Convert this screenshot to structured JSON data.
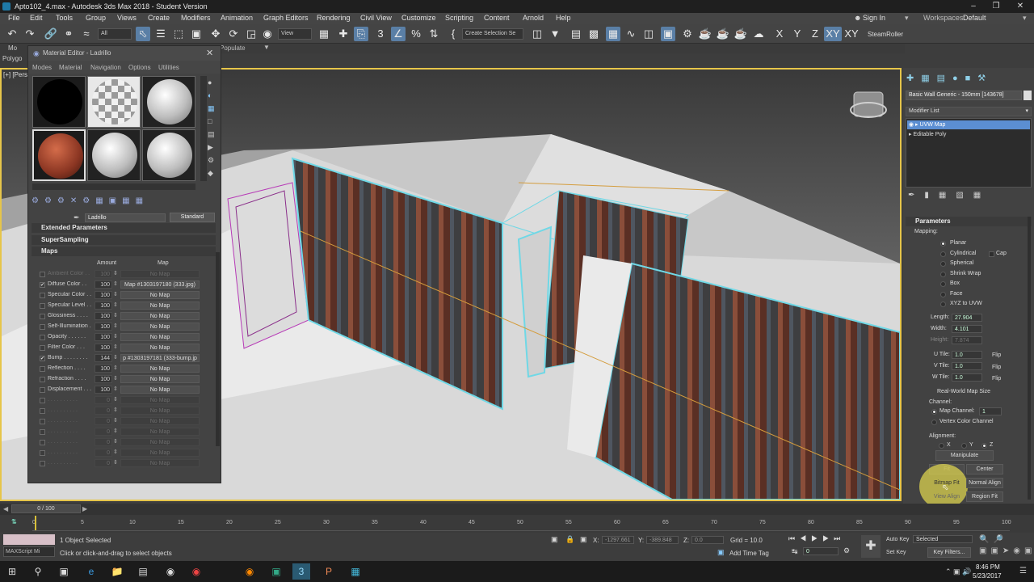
{
  "title": "Apto102_4.max - Autodesk 3ds Max 2018 - Student Version",
  "menu": [
    "File",
    "Edit",
    "Tools",
    "Group",
    "Views",
    "Create",
    "Modifiers",
    "Animation",
    "Graph Editors",
    "Rendering",
    "Civil View",
    "Customize",
    "Scripting",
    "Content",
    "Arnold",
    "Help"
  ],
  "signin": "Sign In",
  "workspaces_label": "Workspaces:",
  "workspace_value": "Default",
  "toolbar": {
    "filter_value": "All",
    "view_value": "View",
    "selection_set": "Create Selection Se",
    "axis_x": "X",
    "axis_y": "Y",
    "axis_z": "Z",
    "axis_xy": "XY",
    "axis_xy2": "XY",
    "steamroller": "SteamRoller"
  },
  "ribbon": {
    "populate": "Populate",
    "modeling": "Mo",
    "polygon": "Polygo"
  },
  "viewport_label": "[+] [Pers",
  "material_editor": {
    "title": "Material Editor - Ladrillo",
    "menu": [
      "Modes",
      "Material",
      "Navigation",
      "Options",
      "Utilities"
    ],
    "material_name": "Ladrillo",
    "material_type": "Standard",
    "rollouts": {
      "extended": "Extended Parameters",
      "supersampling": "SuperSampling",
      "maps": "Maps"
    },
    "col_amount": "Amount",
    "col_map": "Map",
    "maps": [
      {
        "name": "Ambient Color . .",
        "amount": "100",
        "map": "No Map",
        "checked": false,
        "dim": true
      },
      {
        "name": "Diffuse Color . .",
        "amount": "100",
        "map": "Map #1303197180 (333.jpg)",
        "checked": true,
        "dim": false
      },
      {
        "name": "Specular Color . .",
        "amount": "100",
        "map": "No Map",
        "checked": false,
        "dim": false
      },
      {
        "name": "Specular Level . .",
        "amount": "100",
        "map": "No Map",
        "checked": false,
        "dim": false
      },
      {
        "name": "Glossiness . . . .",
        "amount": "100",
        "map": "No Map",
        "checked": false,
        "dim": false
      },
      {
        "name": "Self-Illumination .",
        "amount": "100",
        "map": "No Map",
        "checked": false,
        "dim": false
      },
      {
        "name": "Opacity . . . . . .",
        "amount": "100",
        "map": "No Map",
        "checked": false,
        "dim": false
      },
      {
        "name": "Filter Color . . .",
        "amount": "100",
        "map": "No Map",
        "checked": false,
        "dim": false
      },
      {
        "name": "Bump . . . . . . . .",
        "amount": "144",
        "map": "p #1303197181 (333-bump.jp",
        "checked": true,
        "dim": false
      },
      {
        "name": "Reflection . . . .",
        "amount": "100",
        "map": "No Map",
        "checked": false,
        "dim": false
      },
      {
        "name": "Refraction . . . .",
        "amount": "100",
        "map": "No Map",
        "checked": false,
        "dim": false
      },
      {
        "name": "Displacement . . .",
        "amount": "100",
        "map": "No Map",
        "checked": false,
        "dim": false
      },
      {
        "name": ". . . . . . . . . .",
        "amount": "0",
        "map": "No Map",
        "checked": false,
        "dim": true
      },
      {
        "name": ". . . . . . . . . .",
        "amount": "0",
        "map": "No Map",
        "checked": false,
        "dim": true
      },
      {
        "name": ". . . . . . . . . .",
        "amount": "0",
        "map": "No Map",
        "checked": false,
        "dim": true
      },
      {
        "name": ". . . . . . . . . .",
        "amount": "0",
        "map": "No Map",
        "checked": false,
        "dim": true
      },
      {
        "name": ". . . . . . . . . .",
        "amount": "0",
        "map": "No Map",
        "checked": false,
        "dim": true
      },
      {
        "name": ". . . . . . . . . .",
        "amount": "0",
        "map": "No Map",
        "checked": false,
        "dim": true
      },
      {
        "name": ". . . . . . . . . .",
        "amount": "0",
        "map": "No Map",
        "checked": false,
        "dim": true
      }
    ]
  },
  "command_panel": {
    "object_name": "Basic Wall Generic - 150mm [143678]",
    "modifier_list": "Modifier List",
    "stack": [
      {
        "name": "UVW Map",
        "selected": true
      },
      {
        "name": "Editable Poly",
        "selected": false
      }
    ],
    "parameters": "Parameters",
    "mapping_label": "Mapping:",
    "mapping": [
      {
        "label": "Planar",
        "on": true
      },
      {
        "label": "Cylindrical",
        "on": false
      },
      {
        "label": "Spherical",
        "on": false
      },
      {
        "label": "Shrink Wrap",
        "on": false
      },
      {
        "label": "Box",
        "on": false
      },
      {
        "label": "Face",
        "on": false
      },
      {
        "label": "XYZ to UVW",
        "on": false
      }
    ],
    "cap": "Cap",
    "length_label": "Length:",
    "length": "27.904",
    "width_label": "Width:",
    "width": "4.101",
    "height_label": "Height:",
    "height": "7.874",
    "utile_label": "U Tile:",
    "utile": "1.0",
    "vtile_label": "V Tile:",
    "vtile": "1.0",
    "wtile_label": "W Tile:",
    "wtile": "1.0",
    "flip": "Flip",
    "realworld": "Real-World Map Size",
    "channel_label": "Channel:",
    "map_channel": "Map Channel:",
    "map_channel_value": "1",
    "vertex_color": "Vertex Color Channel",
    "alignment_label": "Alignment:",
    "align_x": "X",
    "align_y": "Y",
    "align_z": "Z",
    "manipulate": "Manipulate",
    "fit": "Fit",
    "center": "Center",
    "bitmap_fit": "Bitmap Fit",
    "normal_align": "Normal Align",
    "view_align": "View Align",
    "region_fit": "Region Fit"
  },
  "timeline": {
    "frame": "0 / 100",
    "ticks": [
      "0",
      "5",
      "10",
      "15",
      "20",
      "25",
      "30",
      "35",
      "40",
      "45",
      "50",
      "55",
      "60",
      "65",
      "70",
      "75",
      "80",
      "85",
      "90",
      "95",
      "100"
    ]
  },
  "status": {
    "maxscript": "MAXScript Mi",
    "selected": "1 Object Selected",
    "prompt": "Click or click-and-drag to select objects",
    "x_label": "X:",
    "x": "-1297.661",
    "y_label": "Y:",
    "y": "-389.848",
    "z_label": "Z:",
    "z": "0.0",
    "grid": "Grid = 10.0",
    "addtimetag": "Add Time Tag",
    "autokey": "Auto Key",
    "setkey": "Set Key",
    "selected_dd": "Selected",
    "keyfilters": "Key Filters...",
    "frame_field": "0"
  },
  "taskbar": {
    "time": "8:46 PM",
    "date": "5/23/2017"
  }
}
